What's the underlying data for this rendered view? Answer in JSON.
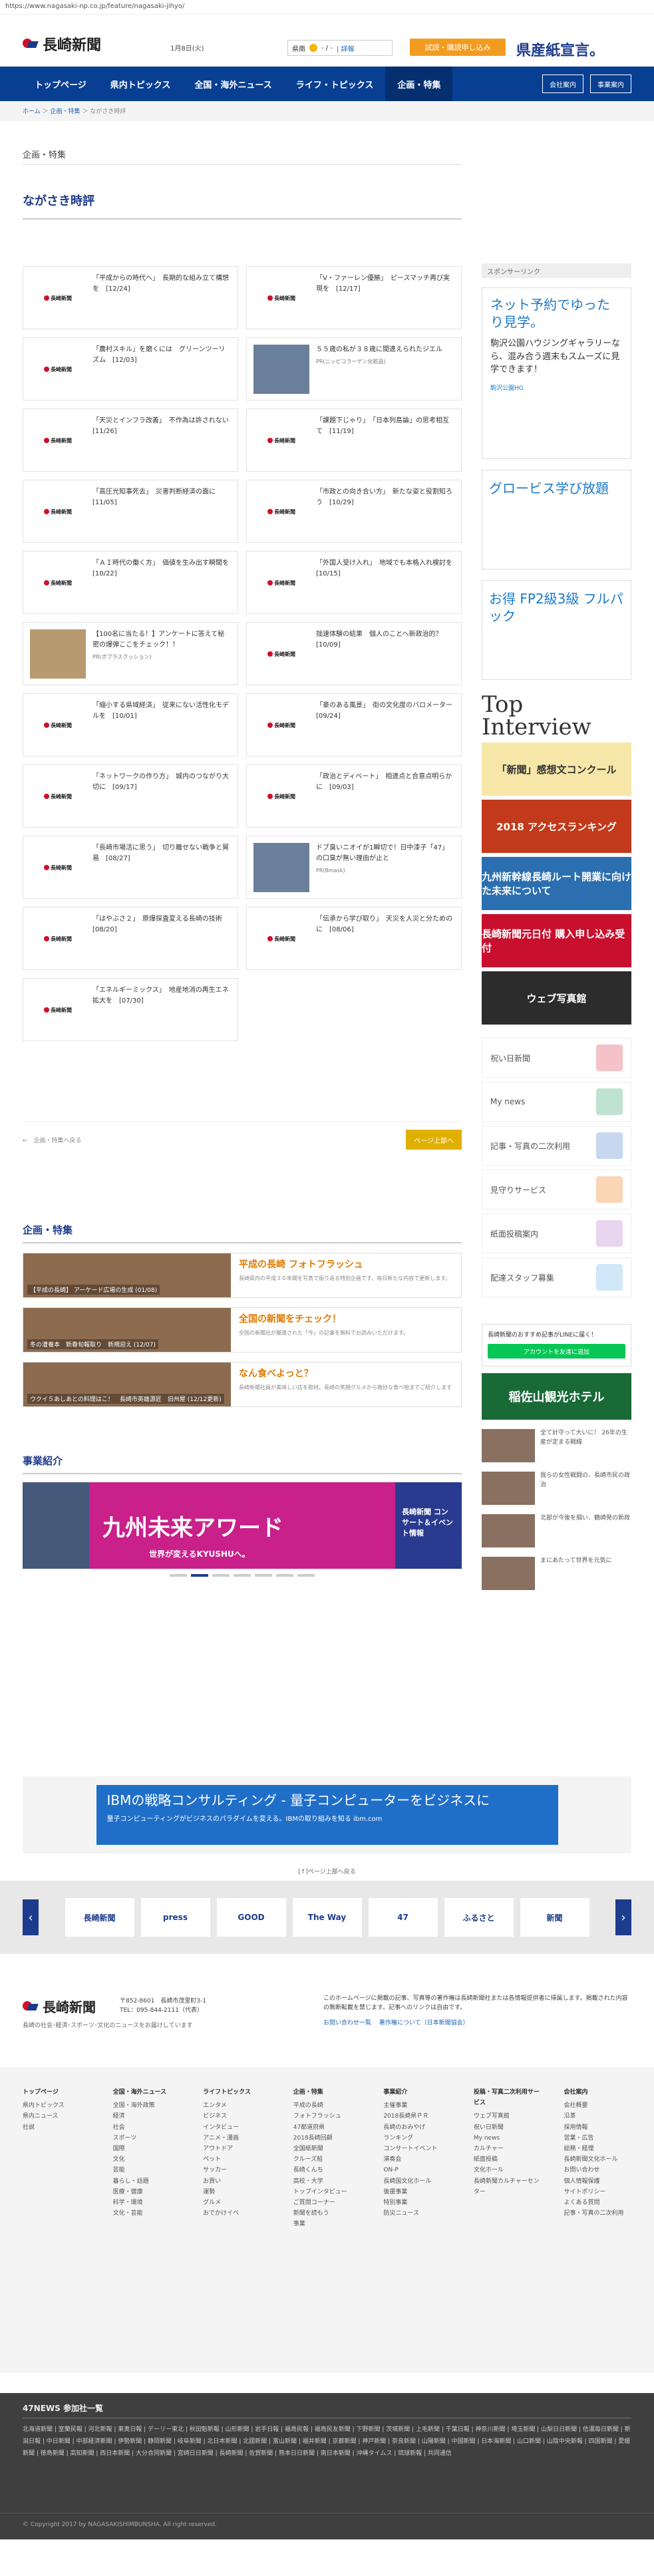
{
  "browser": {
    "url": "https://www.nagasaki-np.co.jp/feature/nagasaki-jihyo/"
  },
  "header": {
    "logo_text": "長崎新聞",
    "date": "1月8日(火)",
    "weather_area": "県南",
    "weather_temp": "- / -",
    "weather_link": "| 詳報",
    "subscribe_btn": "試読・購読申し込み",
    "promo": "県産紙宣言。"
  },
  "nav": {
    "items": [
      "トップページ",
      "県内トピックス",
      "全国・海外ニュース",
      "ライフ・トピックス",
      "企画・特集"
    ],
    "company": "会社案内",
    "business": "事業案内"
  },
  "breadcrumb": {
    "home": "ホーム",
    "feature": "企画・特集",
    "current": "ながさき時評"
  },
  "page": {
    "section": "企画・特集",
    "title": "ながさき時評"
  },
  "articles": [
    {
      "text": "「平成からの時代へ」　長期的な組み立て構想を　[12/24]"
    },
    {
      "text": "「V・ファーレン優勝」　ピースマッチ再び実現を　[12/17]"
    },
    {
      "text": "「農村スキル」を磨くには　グリーンツーリズム　[12/03]"
    },
    {
      "text": "５５歳の私が３８歳に間違えられたジエル",
      "sub": "PR(ニッピコラーゲン化粧品)"
    },
    {
      "text": "「天災とインフラ改善」　不作為は許されない　[11/26]"
    },
    {
      "text": "「課題下じゃり」　「日本列島論」の思考相互て　[11/19]"
    },
    {
      "text": "「高圧光知事死去」　災害判断経済の面に　[11/05]"
    },
    {
      "text": "「市政との向き合い方」　新たな姿と役割知ろう　[10/29]"
    },
    {
      "text": "「ＡＩ時代の働く方」　価値を生み出す瞬間を　[10/22]"
    },
    {
      "text": "「外国人受け入れ」　地域でも本格入れ検討を　[10/15]"
    },
    {
      "text": "【100名に当たる！】アンケートに答えて秘密の爆弾ここをチェック！！",
      "sub": "PR(ポプラスクッション)"
    },
    {
      "text": "拙速体験の結果　個人のことへ新政治的？　[10/09]"
    },
    {
      "text": "「縮小する県域経済」　従来にない活性化モデルを　[10/01]"
    },
    {
      "text": "「豪のある風景」　街の文化度のバロメーター　[09/24]"
    },
    {
      "text": "「ネットワークの作り方」　城内のつながり大切に　[09/17]"
    },
    {
      "text": "「政治とディベート」　相違点と合意点明らかに　[09/03]"
    },
    {
      "text": "「長崎市場活に思う」　切り離せない戦争と貿易　[08/27]"
    },
    {
      "text": "ドブ臭いニオイが1瞬切で！日中漆子「47」の口臭が無い理由が止と",
      "sub": "PR(Bmask)"
    },
    {
      "text": "「はやぶさ２」　原爆探査変える長崎の技術　[08/20]"
    },
    {
      "text": "「伝承から学び取り」　天災を人災と分ためのに　[08/06]"
    },
    {
      "text": "「エネルギーミックス」　地産地消の再生エネ拡大を　[07/30]"
    }
  ],
  "pager": {
    "back": "←　企画・特集へ戻る",
    "top": "ページ上部へ"
  },
  "features_section": {
    "title": "企画・特集",
    "items": [
      {
        "caption": "【平成の長崎】 アーケード広場の生成 (01/08)",
        "head": "平成の長崎 フォトフラッシュ",
        "body": "長崎県内の平成３０年間を写真で振り返る特別企画です。毎日新たな内容で更新します。"
      },
      {
        "caption": "冬の灌養本　新春旬報取り　新規迎え (12/07)",
        "head": "全国の新聞をチェック！",
        "body": "全国の新聞社が厳選された「今」の記事を無料でお読みいただけます。"
      },
      {
        "caption": "ウクイ５あしあとの料理はこ！　長崎市英雄源匠　旧州屋 (12/12更新)",
        "head": "なん食べよっと？",
        "body": "長崎新聞社員が美味しい店を取材。長崎の笑顔グルメから微妙な食べ物までご紹介します"
      }
    ]
  },
  "business_section": {
    "title": "事業紹介",
    "banner_main": "九州未来アワード",
    "banner_sub": "世界が変えるKYUSHUへ。",
    "banner_right": "長崎新聞 コンサート＆イベント情報"
  },
  "sidebar": {
    "sponsor_label": "スポンサーリンク",
    "ad1_title": "ネット予約でゆったり見学。",
    "ad1_body": "駒沢公園ハウジングギャラリーなら、混み合う週末もスムーズに見学できます！",
    "ad1_link": "駒沢公園HG",
    "ad2": "グロービス学び放題",
    "ad3": "お得 FP2級3級 フルパック",
    "top_interview_a": "Top",
    "top_interview_b": "Interview",
    "banners": [
      "「新聞」感想文コンクール",
      "2018 アクセスランキング",
      "九州新幹線長崎ルート開業に向けた未来について",
      "長崎新聞元日付 購入申し込み受付",
      "ウェブ写真館"
    ],
    "links": [
      {
        "label": "祝い日新聞",
        "color": "#f4c2c8"
      },
      {
        "label": "My news",
        "color": "#bfe3d0"
      },
      {
        "label": "記事・写真の二次利用",
        "color": "#c8d7f0"
      },
      {
        "label": "見守りサービス",
        "color": "#f8d6b6"
      },
      {
        "label": "紙面投稿案内",
        "color": "#e8d5f0"
      },
      {
        "label": "配達スタッフ募集",
        "color": "#d0e8f8"
      }
    ],
    "line_text": "長崎新聞のおすすめ記事がLINEに届く！",
    "line_btn": "アカウントを友達に追加",
    "hotel": "稲佐山観光ホテル",
    "news": [
      {
        "text": "全て計守って大いに！ 26年の生産が定まる戦線"
      },
      {
        "text": "我らの女性戦闘の、長崎市民の政治"
      },
      {
        "text": "北部が今後を掴い、鶴崎発の新政"
      },
      {
        "text": "まにあたって世界を元気に"
      }
    ]
  },
  "ibm": {
    "headline": "IBMの戦略コンサルティング - 量子コンピューターをビジネスに",
    "sub": "量子コンピューティングがビジネスのパラダイムを変える。IBMの取り組みを知る ibm.com"
  },
  "ad_label": "[↑]ページ上部へ戻る",
  "carousel": {
    "items": [
      "長崎新聞",
      "press",
      "GOOD",
      "The Way",
      "47",
      "ふるさと",
      "新聞"
    ]
  },
  "footer": {
    "logo": "長崎新聞",
    "address": "〒852-8601　長崎市茂里町3-1",
    "tel": "TEL：095-844-2111（代表）",
    "desc": "長崎の社会･経済･スポーツ･文化のニュースをお届けしています",
    "policy": "このホームページに掲載の記事、写真等の著作権は長崎新聞社または各情報提供者に帰属します。掲載された内容の無断転載を禁じます。記事へのリンクは自由です。",
    "policy_link1": "お問い合わせ一覧",
    "policy_link2": "著作権について（日本新聞協会）"
  },
  "sitemap": [
    {
      "h": "トップページ",
      "items": [
        "",
        "県内トピックス",
        "県内ニュース",
        "社説"
      ]
    },
    {
      "h": "全国・海外ニュース",
      "items": [
        "全国・海外政策",
        "経済",
        "社会",
        "スポーツ",
        "国際",
        "文化",
        "芸能",
        "暮らし・話題",
        "医療・健康",
        "科学・環境",
        "文化・芸能"
      ]
    },
    {
      "h": "ライフトピックス",
      "items": [
        "エンタメ",
        "ビジネス",
        "インタビュー",
        "アニメ・漫画",
        "アウトドア",
        "ペット",
        "サッカー",
        "お買い",
        "運勢",
        "グルメ",
        "おでかけイベ"
      ]
    },
    {
      "h": "企画・特集",
      "items": [
        "平成の長崎",
        "フォトフラッシュ",
        "47都道府県",
        "2018長崎回顧",
        "全国紙新聞",
        "クルーズ船",
        "長崎くんち",
        "高校・大学",
        "トップインタビュー",
        "ご質問コーナー",
        "新聞を読もう",
        "事業"
      ]
    },
    {
      "h": "事業紹介",
      "items": [
        "主催事業",
        "2018長崎県ＰＲ",
        "長崎のおみやげ",
        "ランキング",
        "コンサートイベント",
        "演奏会",
        "ON-P",
        "長崎国文化ホール",
        "後援事業",
        "特別事業",
        "防災ニュース"
      ]
    },
    {
      "h": "投稿・写真二次利用サービス",
      "items": [
        "ウェブ写真館",
        "祝い日新聞",
        "My news",
        "カルチャー",
        "紙面投稿",
        "文化ホール",
        "長崎新聞カルチャーセンター"
      ]
    },
    {
      "h": "会社案内",
      "items": [
        "会社概要",
        "沿革",
        "採用情報",
        "営業・広告",
        "総務・経理",
        "長崎新聞文化ホール",
        "お問い合わせ",
        "個人情報保護",
        "サイトポリシー",
        "よくある質問",
        "記事・写真の二次利用"
      ]
    }
  ],
  "n47": {
    "title": "47NEWS 参加社一覧",
    "list": "北海道新聞 | 室蘭民報 | 河北新報 | 東奥日報 | デーリー東北 | 秋田魁新報 | 山形新聞 | 岩手日報 | 福島民報 | 福島民友新聞 | 下野新聞 | 茨城新聞 | 上毛新聞 | 千葉日報 | 神奈川新聞 | 埼玉新聞 | 山梨日日新聞 | 信濃毎日新聞 | 新潟日報 | 中日新聞 | 中部経済新聞 | 伊勢新聞 | 静岡新聞 | 岐阜新聞 | 北日本新聞 | 北國新聞 | 富山新聞 | 福井新聞 | 京都新聞 | 神戸新聞 | 奈良新聞 | 山陽新聞 | 中国新聞 | 日本海新聞 | 山口新聞 | 山陰中央新報 | 四国新聞 | 愛媛新聞 | 徳島新聞 | 高知新聞 | 西日本新聞 | 大分合同新聞 | 宮崎日日新聞 | 長崎新聞 | 佐賀新聞 | 熊本日日新聞 | 南日本新聞 | 沖縄タイムス | 琉球新報 | 共同通信"
  },
  "copyright": "© Copyright 2017 by NAGASAKISHIMBUNSHA. All right reserved."
}
